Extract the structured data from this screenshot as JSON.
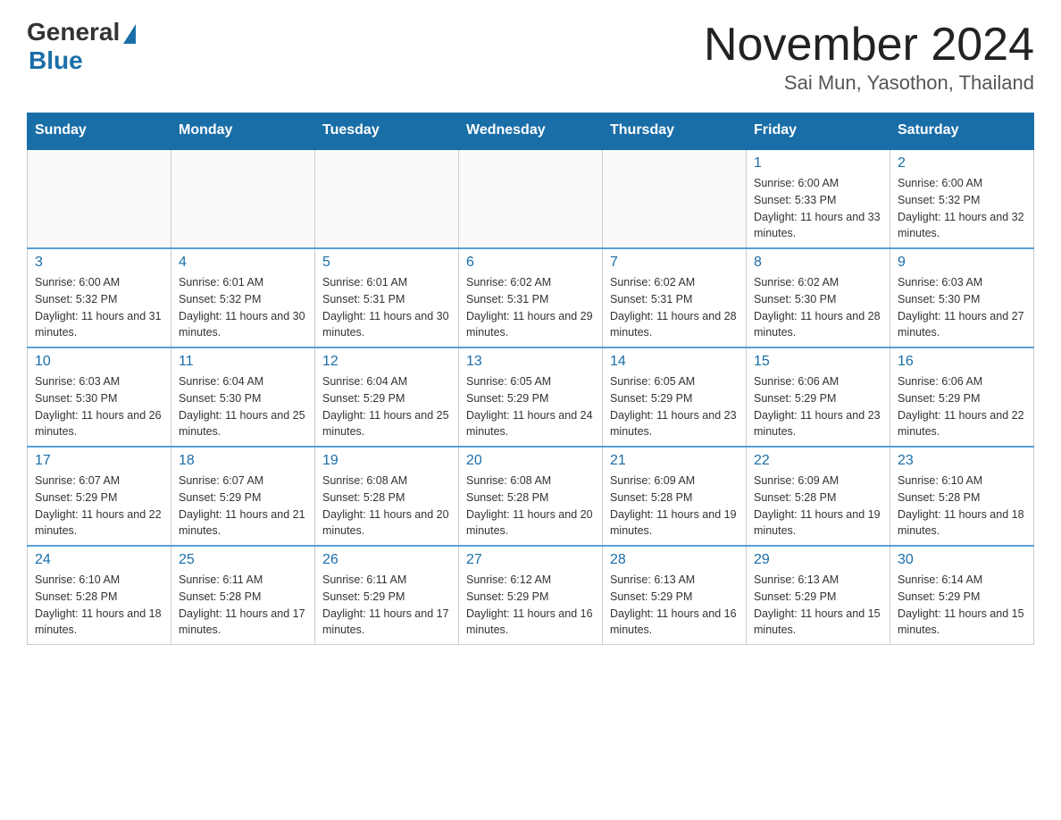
{
  "header": {
    "logo_general": "General",
    "logo_blue": "Blue",
    "main_title": "November 2024",
    "subtitle": "Sai Mun, Yasothon, Thailand"
  },
  "days_of_week": [
    "Sunday",
    "Monday",
    "Tuesday",
    "Wednesday",
    "Thursday",
    "Friday",
    "Saturday"
  ],
  "weeks": [
    [
      {
        "day": "",
        "info": ""
      },
      {
        "day": "",
        "info": ""
      },
      {
        "day": "",
        "info": ""
      },
      {
        "day": "",
        "info": ""
      },
      {
        "day": "",
        "info": ""
      },
      {
        "day": "1",
        "info": "Sunrise: 6:00 AM\nSunset: 5:33 PM\nDaylight: 11 hours and 33 minutes."
      },
      {
        "day": "2",
        "info": "Sunrise: 6:00 AM\nSunset: 5:32 PM\nDaylight: 11 hours and 32 minutes."
      }
    ],
    [
      {
        "day": "3",
        "info": "Sunrise: 6:00 AM\nSunset: 5:32 PM\nDaylight: 11 hours and 31 minutes."
      },
      {
        "day": "4",
        "info": "Sunrise: 6:01 AM\nSunset: 5:32 PM\nDaylight: 11 hours and 30 minutes."
      },
      {
        "day": "5",
        "info": "Sunrise: 6:01 AM\nSunset: 5:31 PM\nDaylight: 11 hours and 30 minutes."
      },
      {
        "day": "6",
        "info": "Sunrise: 6:02 AM\nSunset: 5:31 PM\nDaylight: 11 hours and 29 minutes."
      },
      {
        "day": "7",
        "info": "Sunrise: 6:02 AM\nSunset: 5:31 PM\nDaylight: 11 hours and 28 minutes."
      },
      {
        "day": "8",
        "info": "Sunrise: 6:02 AM\nSunset: 5:30 PM\nDaylight: 11 hours and 28 minutes."
      },
      {
        "day": "9",
        "info": "Sunrise: 6:03 AM\nSunset: 5:30 PM\nDaylight: 11 hours and 27 minutes."
      }
    ],
    [
      {
        "day": "10",
        "info": "Sunrise: 6:03 AM\nSunset: 5:30 PM\nDaylight: 11 hours and 26 minutes."
      },
      {
        "day": "11",
        "info": "Sunrise: 6:04 AM\nSunset: 5:30 PM\nDaylight: 11 hours and 25 minutes."
      },
      {
        "day": "12",
        "info": "Sunrise: 6:04 AM\nSunset: 5:29 PM\nDaylight: 11 hours and 25 minutes."
      },
      {
        "day": "13",
        "info": "Sunrise: 6:05 AM\nSunset: 5:29 PM\nDaylight: 11 hours and 24 minutes."
      },
      {
        "day": "14",
        "info": "Sunrise: 6:05 AM\nSunset: 5:29 PM\nDaylight: 11 hours and 23 minutes."
      },
      {
        "day": "15",
        "info": "Sunrise: 6:06 AM\nSunset: 5:29 PM\nDaylight: 11 hours and 23 minutes."
      },
      {
        "day": "16",
        "info": "Sunrise: 6:06 AM\nSunset: 5:29 PM\nDaylight: 11 hours and 22 minutes."
      }
    ],
    [
      {
        "day": "17",
        "info": "Sunrise: 6:07 AM\nSunset: 5:29 PM\nDaylight: 11 hours and 22 minutes."
      },
      {
        "day": "18",
        "info": "Sunrise: 6:07 AM\nSunset: 5:29 PM\nDaylight: 11 hours and 21 minutes."
      },
      {
        "day": "19",
        "info": "Sunrise: 6:08 AM\nSunset: 5:28 PM\nDaylight: 11 hours and 20 minutes."
      },
      {
        "day": "20",
        "info": "Sunrise: 6:08 AM\nSunset: 5:28 PM\nDaylight: 11 hours and 20 minutes."
      },
      {
        "day": "21",
        "info": "Sunrise: 6:09 AM\nSunset: 5:28 PM\nDaylight: 11 hours and 19 minutes."
      },
      {
        "day": "22",
        "info": "Sunrise: 6:09 AM\nSunset: 5:28 PM\nDaylight: 11 hours and 19 minutes."
      },
      {
        "day": "23",
        "info": "Sunrise: 6:10 AM\nSunset: 5:28 PM\nDaylight: 11 hours and 18 minutes."
      }
    ],
    [
      {
        "day": "24",
        "info": "Sunrise: 6:10 AM\nSunset: 5:28 PM\nDaylight: 11 hours and 18 minutes."
      },
      {
        "day": "25",
        "info": "Sunrise: 6:11 AM\nSunset: 5:28 PM\nDaylight: 11 hours and 17 minutes."
      },
      {
        "day": "26",
        "info": "Sunrise: 6:11 AM\nSunset: 5:29 PM\nDaylight: 11 hours and 17 minutes."
      },
      {
        "day": "27",
        "info": "Sunrise: 6:12 AM\nSunset: 5:29 PM\nDaylight: 11 hours and 16 minutes."
      },
      {
        "day": "28",
        "info": "Sunrise: 6:13 AM\nSunset: 5:29 PM\nDaylight: 11 hours and 16 minutes."
      },
      {
        "day": "29",
        "info": "Sunrise: 6:13 AM\nSunset: 5:29 PM\nDaylight: 11 hours and 15 minutes."
      },
      {
        "day": "30",
        "info": "Sunrise: 6:14 AM\nSunset: 5:29 PM\nDaylight: 11 hours and 15 minutes."
      }
    ]
  ]
}
